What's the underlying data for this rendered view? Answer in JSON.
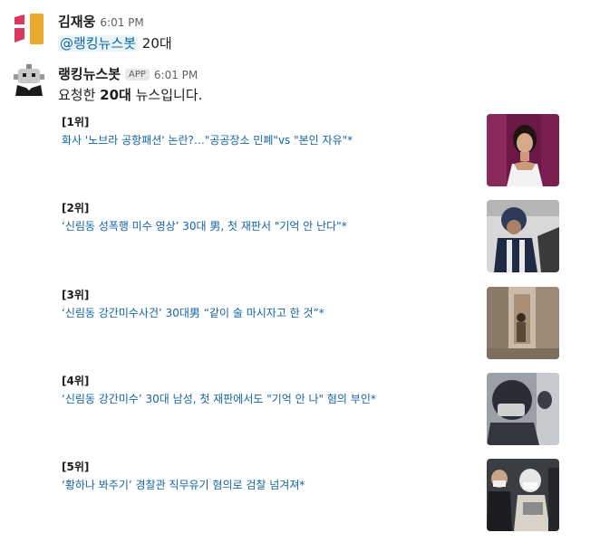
{
  "messages": [
    {
      "sender": "김재웅",
      "time": "6:01 PM",
      "mention": "@랭킹뉴스봇",
      "text": " 20대"
    },
    {
      "sender": "랭킹뉴스봇",
      "badge": "APP",
      "time": "6:01 PM",
      "text_pre": "요청한 ",
      "text_bold": "20대",
      "text_post": " 뉴스입니다."
    }
  ],
  "news": [
    {
      "rank": "[1위]",
      "title": "화사 '노브라 공항패션' 논란?…\"공공장소 민폐\"vs \"본인 자유\"*"
    },
    {
      "rank": "[2위]",
      "title": "‘신림동 성폭행 미수 영상’ 30대 男, 첫 재판서 \"기억 안 난다\"*"
    },
    {
      "rank": "[3위]",
      "title": "‘신림동 강간미수사건’ 30대男 “같이 술 마시자고 한 것”*"
    },
    {
      "rank": "[4위]",
      "title": "‘신림동 강간미수’ 30대 남성, 첫 재판에서도 \"기억 안 나\" 혐의 부인*"
    },
    {
      "rank": "[5위]",
      "title": "‘황하나 봐주기’ 경찰관 직무유기 혐의로 검찰 넘겨져*"
    }
  ],
  "colors": {
    "link": "#1264a3",
    "mention_bg": "#e8f5fa"
  }
}
